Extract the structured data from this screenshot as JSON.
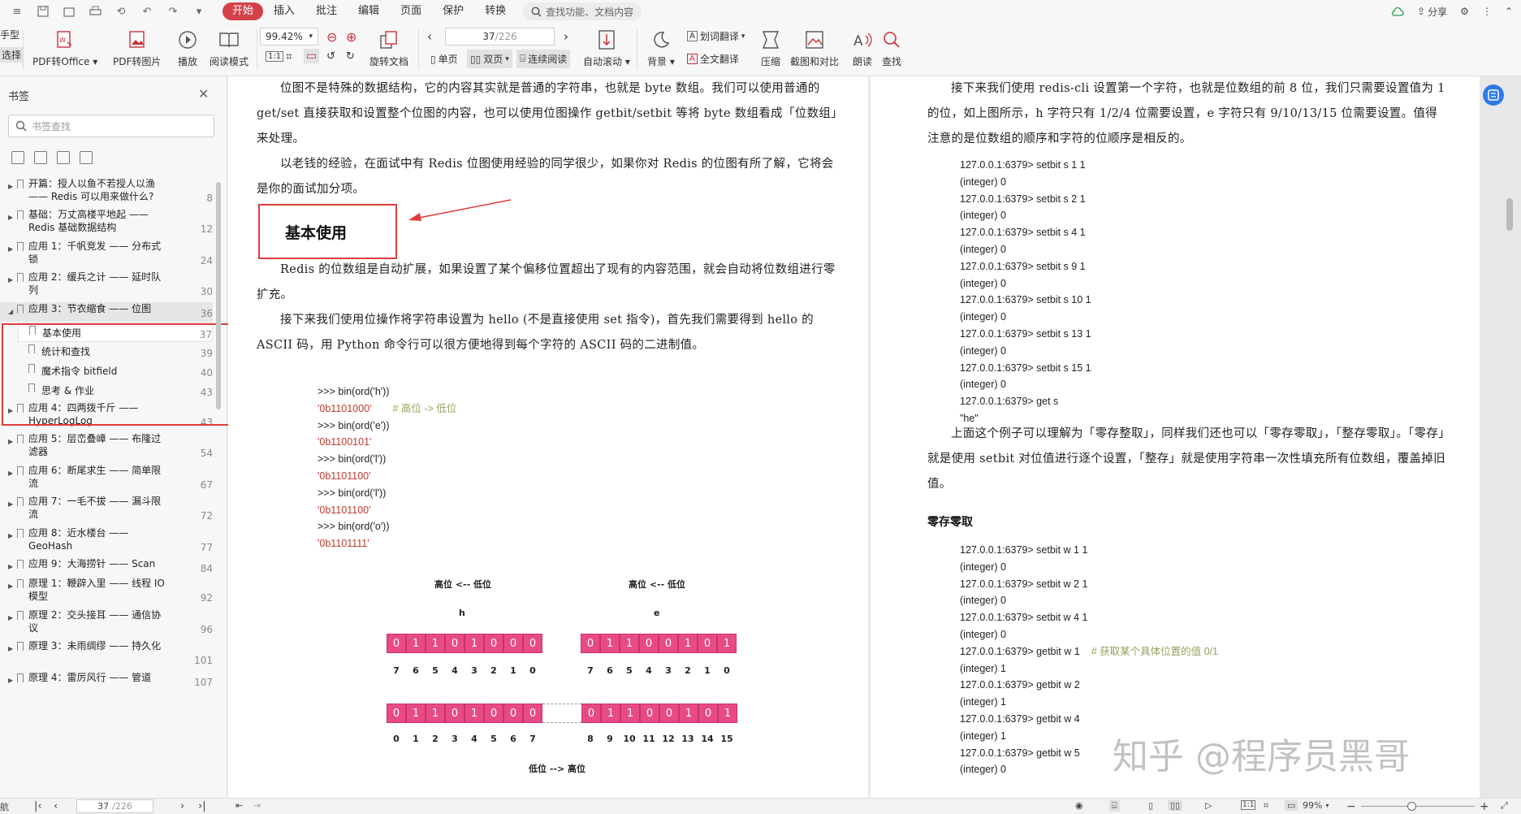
{
  "app": {
    "quick_access": [
      "≡",
      "□",
      "⎙",
      "⟲",
      "↶",
      "↷",
      "▾"
    ],
    "tabs": [
      "开始",
      "插入",
      "批注",
      "编辑",
      "页面",
      "保护",
      "转换"
    ],
    "search_placeholder": "查找功能、文档内容",
    "share_label": "分享"
  },
  "ribbon": {
    "left_cut_1": "手型",
    "left_cut_2": "选择",
    "pdf_to_office": "PDF转Office",
    "pdf_to_image": "PDF转图片",
    "play": "播放",
    "reading_mode": "阅读模式",
    "zoom": "99.42%",
    "page_input": "37",
    "page_total": "/226",
    "rotate_doc": "旋转文档",
    "single_page": "单页",
    "double_page": "双页",
    "continuous": "连续阅读",
    "auto_scroll": "自动滚动",
    "background": "背景",
    "word_translate": "划词翻译",
    "full_translate": "全文翻译",
    "compress": "压缩",
    "screenshot_compare": "截图和对比",
    "read_aloud": "朗读",
    "find": "查找"
  },
  "sidebar": {
    "title": "书签",
    "search_placeholder": "书签查找",
    "items": [
      {
        "text": "开篇：授人以鱼不若授人以渔 —— Redis 可以用来做什么?",
        "page": "8"
      },
      {
        "text": "基础：万丈高楼平地起 ——Redis 基础数据结构",
        "page": "12"
      },
      {
        "text": "应用 1：千帆竞发 —— 分布式锁",
        "page": "24"
      },
      {
        "text": "应用 2：缓兵之计 —— 延时队列",
        "page": "30"
      },
      {
        "text": "应用 3：节衣缩食 —— 位图",
        "page": "36"
      },
      {
        "text": "基本使用",
        "page": "37"
      },
      {
        "text": "统计和查找",
        "page": "39"
      },
      {
        "text": "魔术指令 bitfield",
        "page": "40"
      },
      {
        "text": "思考 & 作业",
        "page": "43"
      },
      {
        "text": "应用 4：四两拨千斤 —— HyperLogLog",
        "page": "43"
      },
      {
        "text": "应用 5：层峦叠嶂 —— 布隆过滤器",
        "page": "54"
      },
      {
        "text": "应用 6：断尾求生 —— 简单限流",
        "page": "67"
      },
      {
        "text": "应用 7：一毛不拔 —— 漏斗限流",
        "page": "72"
      },
      {
        "text": "应用 8：近水楼台 —— GeoHash",
        "page": "77"
      },
      {
        "text": "应用 9：大海捞针 —— Scan",
        "page": "84"
      },
      {
        "text": "原理 1：鞭辟入里 —— 线程 IO 模型",
        "page": "92"
      },
      {
        "text": "原理 2：交头接耳 —— 通信协议",
        "page": "96"
      },
      {
        "text": "原理 3：未雨绸缪 —— 持久化",
        "page": "101"
      },
      {
        "text": "原理 4：雷厉风行 —— 管道",
        "page": "107"
      }
    ]
  },
  "page_left": {
    "p1": "位图不是特殊的数据结构，它的内容其实就是普通的字符串，也就是 byte 数组。我们可以使用普通的 get/set 直接获取和设置整个位图的内容，也可以使用位图操作 getbit/setbit 等将 byte 数组看成「位数组」来处理。",
    "p2": "以老钱的经验，在面试中有 Redis 位图使用经验的同学很少，如果你对 Redis 的位图有所了解，它将会是你的面试加分项。",
    "heading": "基本使用",
    "p3": "Redis 的位数组是自动扩展，如果设置了某个偏移位置超出了现有的内容范围，就会自动将位数组进行零扩充。",
    "p4": "接下来我们使用位操作将字符串设置为 hello (不是直接使用 set 指令)，首先我们需要得到 hello 的 ASCII 码，用 Python 命令行可以很方便地得到每个字符的 ASCII 码的二进制值。",
    "code": [
      {
        "t": ">>> bin(ord('h'))",
        "c": ""
      },
      {
        "t": "'0b1101000'",
        "c": "red",
        "cm": "# 高位 -> 低位"
      },
      {
        "t": ">>> bin(ord('e'))",
        "c": ""
      },
      {
        "t": "'0b1100101'",
        "c": "red"
      },
      {
        "t": ">>> bin(ord('l'))",
        "c": ""
      },
      {
        "t": "'0b1101100'",
        "c": "red"
      },
      {
        "t": ">>> bin(ord('l'))",
        "c": ""
      },
      {
        "t": "'0b1101100'",
        "c": "red"
      },
      {
        "t": ">>> bin(ord('o'))",
        "c": ""
      },
      {
        "t": "'0b1101111'",
        "c": "red"
      }
    ],
    "diagram": {
      "label_left": "高位 <-- 低位",
      "label_right": "高位 <-- 低位",
      "char_h": "h",
      "char_e": "e",
      "bits_h": [
        "0",
        "1",
        "1",
        "0",
        "1",
        "0",
        "0",
        "0"
      ],
      "bits_e": [
        "0",
        "1",
        "1",
        "0",
        "0",
        "1",
        "0",
        "1"
      ],
      "idx_desc": [
        "7",
        "6",
        "5",
        "4",
        "3",
        "2",
        "1",
        "0"
      ],
      "idx_asc_1": [
        "0",
        "1",
        "2",
        "3",
        "4",
        "5",
        "6",
        "7"
      ],
      "idx_asc_2": [
        "8",
        "9",
        "10",
        "11",
        "12",
        "13",
        "14",
        "15"
      ],
      "bottom_label": "低位 --> 高位"
    }
  },
  "page_right": {
    "p1": "接下来我们使用 redis-cli 设置第一个字符，也就是位数组的前 8 位，我们只需要设置值为 1 的位，如上图所示，h 字符只有 1/2/4 位需要设置，e 字符只有 9/10/13/15 位需要设置。值得注意的是位数组的顺序和字符的位顺序是相反的。",
    "code1": [
      "127.0.0.1:6379> setbit s 1 1",
      "(integer) 0",
      "127.0.0.1:6379> setbit s 2 1",
      "(integer) 0",
      "127.0.0.1:6379> setbit s 4 1",
      "(integer) 0",
      "127.0.0.1:6379> setbit s 9 1",
      "(integer) 0",
      "127.0.0.1:6379> setbit s 10 1",
      "(integer) 0",
      "127.0.0.1:6379> setbit s 13 1",
      "(integer) 0",
      "127.0.0.1:6379> setbit s 15 1",
      "(integer) 0",
      "127.0.0.1:6379> get s",
      "\"he\""
    ],
    "p2": "上面这个例子可以理解为「零存整取」，同样我们还也可以「零存零取」，「整存零取」。「零存」就是使用 setbit 对位值进行逐个设置，「整存」就是使用字符串一次性填充所有位数组，覆盖掉旧值。",
    "heading": "零存零取",
    "code2": [
      {
        "t": "127.0.0.1:6379> setbit w 1 1"
      },
      {
        "t": "(integer) 0"
      },
      {
        "t": "127.0.0.1:6379> setbit w 2 1"
      },
      {
        "t": "(integer) 0"
      },
      {
        "t": "127.0.0.1:6379> setbit w 4 1"
      },
      {
        "t": "(integer) 0"
      },
      {
        "t": "127.0.0.1:6379> getbit w 1",
        "cm": "# 获取某个具体位置的值 0/1"
      },
      {
        "t": "(integer) 1"
      },
      {
        "t": "127.0.0.1:6379> getbit w 2"
      },
      {
        "t": "(integer) 1"
      },
      {
        "t": "127.0.0.1:6379> getbit w 4"
      },
      {
        "t": "(integer) 1"
      },
      {
        "t": "127.0.0.1:6379> getbit w 5"
      },
      {
        "t": "(integer) 0"
      }
    ]
  },
  "watermark": "知乎 @程序员黑哥",
  "status": {
    "left_label": "航",
    "page_input": "37",
    "page_total": "/226",
    "zoom": "99%"
  }
}
